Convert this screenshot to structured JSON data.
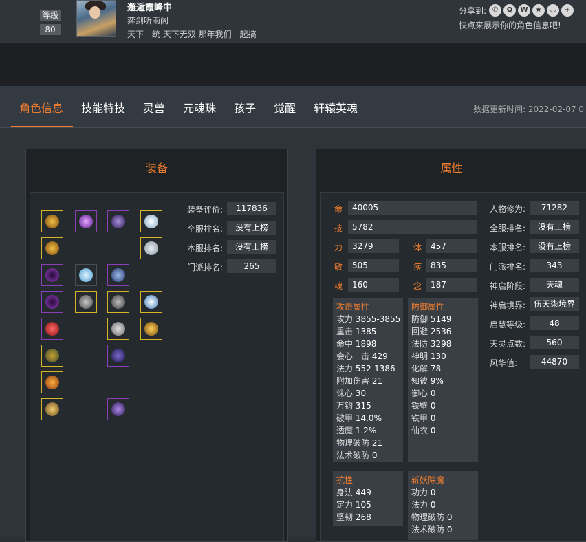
{
  "header": {
    "level_label": "等级",
    "level_value": "80",
    "name": "邂逅霞峰中",
    "sect": "弈剑听雨阁",
    "motto": "天下一统 天下无双 那年我们一起搞",
    "share_label": "分享到:",
    "share_icons": [
      "wechat-icon",
      "qq-icon",
      "weibo-icon",
      "qzone-icon",
      "tencent-icon",
      "more-icon"
    ],
    "share_hint": "快点来展示你的角色信息吧!"
  },
  "tabs": [
    "角色信息",
    "技能特技",
    "灵兽",
    "元魂珠",
    "孩子",
    "觉醒",
    "轩辕英魂"
  ],
  "update_time": "数据更新时间: 2022-02-07 0",
  "equipment": {
    "title": "装备",
    "stats": [
      {
        "label": "装备评价:",
        "value": "117836"
      },
      {
        "label": "全服排名:",
        "value": "没有上榜"
      },
      {
        "label": "本服排名:",
        "value": "没有上榜"
      },
      {
        "label": "门派排名:",
        "value": "265"
      }
    ]
  },
  "attributes": {
    "title": "属性",
    "rows": [
      {
        "k": "命",
        "v": "40005"
      },
      {
        "k": "技",
        "v": "5782"
      }
    ],
    "pairs": [
      [
        {
          "k": "力",
          "v": "3279"
        },
        {
          "k": "体",
          "v": "457"
        }
      ],
      [
        {
          "k": "敏",
          "v": "505"
        },
        {
          "k": "疾",
          "v": "835"
        }
      ],
      [
        {
          "k": "魂",
          "v": "160"
        },
        {
          "k": "念",
          "v": "187"
        }
      ]
    ],
    "right": [
      {
        "label": "人物修为:",
        "value": "71282"
      },
      {
        "label": "全服排名:",
        "value": "没有上榜"
      },
      {
        "label": "本服排名:",
        "value": "没有上榜"
      },
      {
        "label": "门派排名:",
        "value": "343"
      },
      {
        "label": "神启阶段:",
        "value": "天魂"
      },
      {
        "label": "神启境界:",
        "value": "伍天柒境界"
      },
      {
        "label": "启慧等级:",
        "value": "48"
      },
      {
        "label": "天灵点数:",
        "value": "560"
      },
      {
        "label": "风华值:",
        "value": "44870"
      }
    ],
    "attack": {
      "title": "攻击属性",
      "items": [
        {
          "k": "攻力",
          "v": "3855-3855"
        },
        {
          "k": "重击",
          "v": "1385"
        },
        {
          "k": "命中",
          "v": "1898"
        },
        {
          "k": "会心一击",
          "v": "429"
        },
        {
          "k": "法力",
          "v": "552-1386"
        },
        {
          "k": "附加伤害",
          "v": "21"
        },
        {
          "k": "诛心",
          "v": "30"
        },
        {
          "k": "万钧",
          "v": "315"
        },
        {
          "k": "破甲",
          "v": "14.0%"
        },
        {
          "k": "透魔",
          "v": "1.2%"
        },
        {
          "k": "物理破防",
          "v": "21"
        },
        {
          "k": "法术破防",
          "v": "0"
        }
      ]
    },
    "defense": {
      "title": "防御属性",
      "items": [
        {
          "k": "防御",
          "v": "5149"
        },
        {
          "k": "回避",
          "v": "2536"
        },
        {
          "k": "法防",
          "v": "3298"
        },
        {
          "k": "神明",
          "v": "130"
        },
        {
          "k": "化解",
          "v": "78"
        },
        {
          "k": "知彼",
          "v": "9%"
        },
        {
          "k": "御心",
          "v": "0"
        },
        {
          "k": "铁壁",
          "v": "0"
        },
        {
          "k": "铁甲",
          "v": "0"
        },
        {
          "k": "仙衣",
          "v": "0"
        }
      ]
    },
    "resist": {
      "title": "抗性",
      "items": [
        {
          "k": "身法",
          "v": "449"
        },
        {
          "k": "定力",
          "v": "105"
        },
        {
          "k": "坚韧",
          "v": "268"
        }
      ]
    },
    "demon": {
      "title": "斩妖除魔",
      "items": [
        {
          "k": "功力",
          "v": "0"
        },
        {
          "k": "法力",
          "v": "0"
        },
        {
          "k": "物理破防",
          "v": "0"
        },
        {
          "k": "法术破防",
          "v": "0"
        }
      ]
    }
  },
  "colors": {
    "accent": "#ef7d2f",
    "gold_border": "#d7b423",
    "purple_border": "#8a3fb8"
  }
}
